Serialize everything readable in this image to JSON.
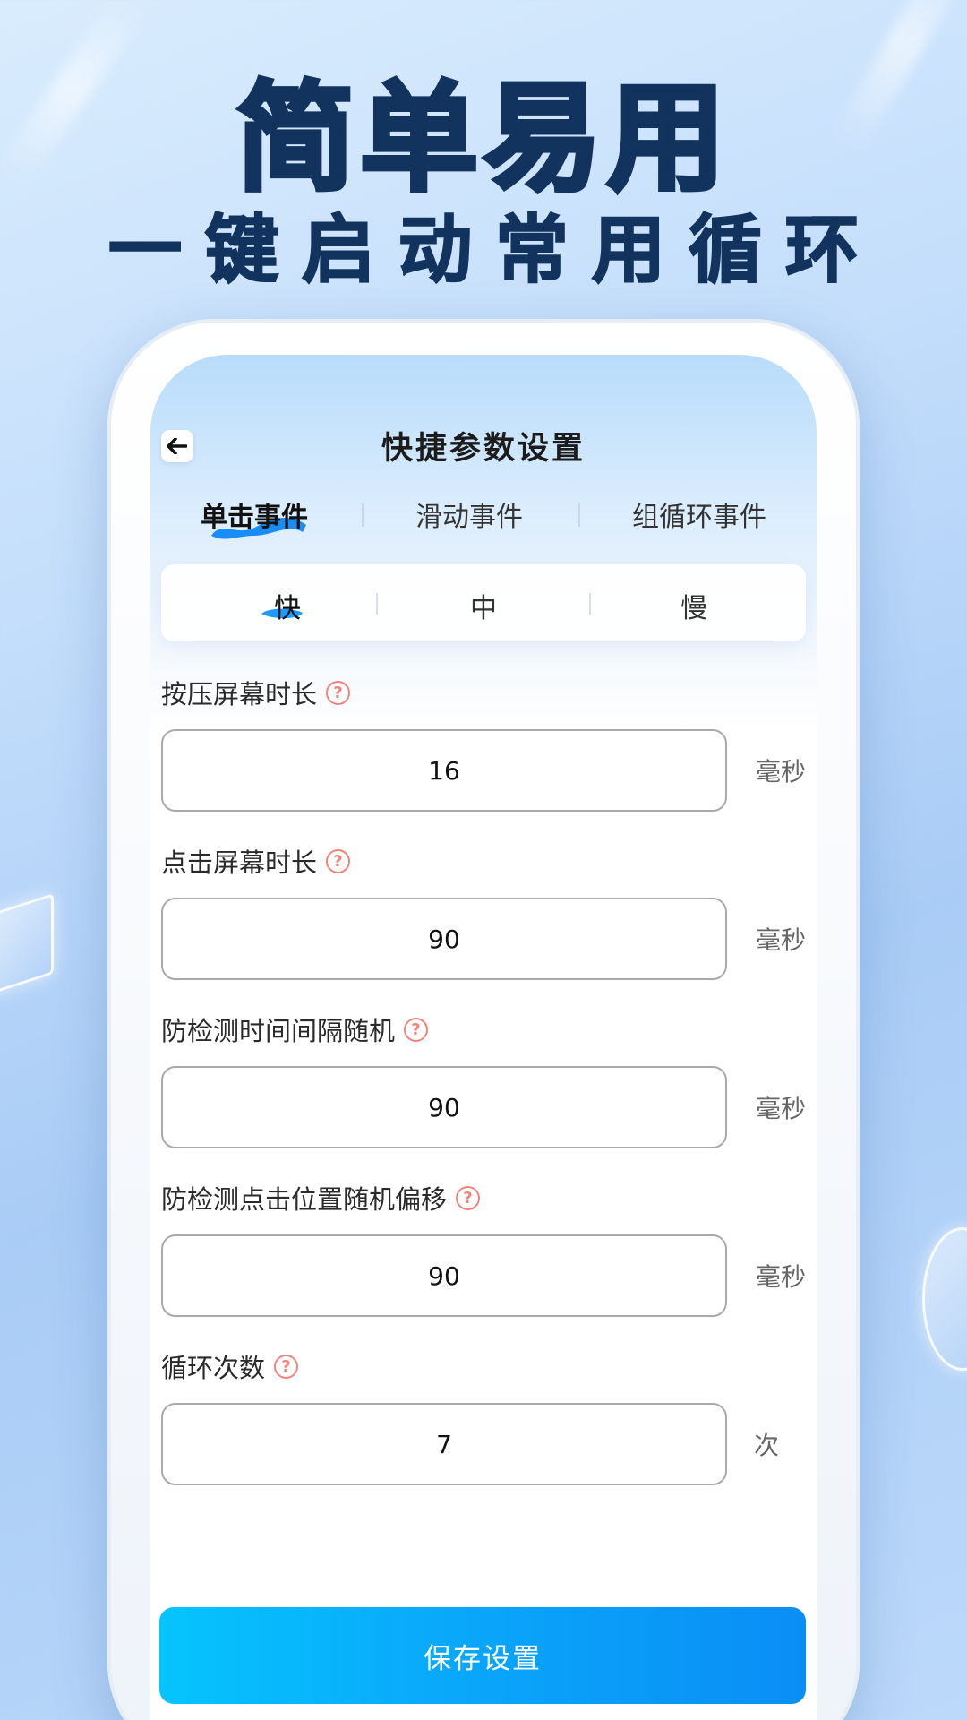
{
  "promo": {
    "title": "简单易用",
    "subtitle": "一键启动常用循环"
  },
  "screen": {
    "title": "快捷参数设置",
    "tabs": [
      {
        "label": "单击事件",
        "active": true
      },
      {
        "label": "滑动事件",
        "active": false
      },
      {
        "label": "组循环事件",
        "active": false
      }
    ],
    "speeds": [
      {
        "label": "快",
        "active": true
      },
      {
        "label": "中",
        "active": false
      },
      {
        "label": "慢",
        "active": false
      }
    ],
    "fields": [
      {
        "label": "按压屏幕时长",
        "value": "16",
        "unit": "毫秒"
      },
      {
        "label": "点击屏幕时长",
        "value": "90",
        "unit": "毫秒"
      },
      {
        "label": "防检测时间间隔随机",
        "value": "90",
        "unit": "毫秒"
      },
      {
        "label": "防检测点击位置随机偏移",
        "value": "90",
        "unit": "毫秒"
      },
      {
        "label": "循环次数",
        "value": "7",
        "unit": "次"
      }
    ],
    "help_symbol": "?",
    "save_label": "保存设置"
  },
  "colors": {
    "headline": "#12335e",
    "accent": "#0aa5fa",
    "help": "#f0857c"
  },
  "icons": {
    "back": "arrow-left-icon",
    "help": "question-circle-icon"
  }
}
